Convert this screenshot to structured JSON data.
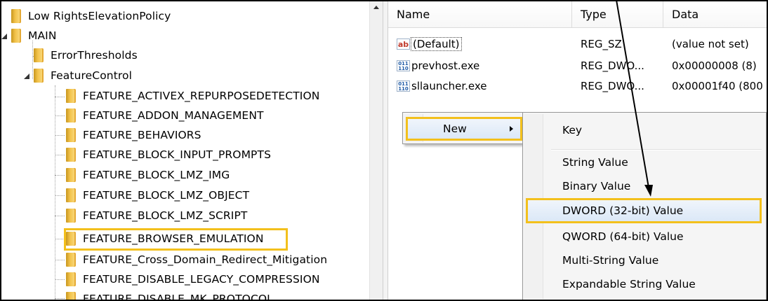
{
  "tree": {
    "items": [
      {
        "label": "Low RightsElevationPolicy",
        "state": "collapsed"
      },
      {
        "label": "MAIN",
        "state": "expanded"
      },
      {
        "label": "ErrorThresholds",
        "state": "leaf"
      },
      {
        "label": "FeatureControl",
        "state": "expanded"
      },
      {
        "label": "FEATURE_ACTIVEX_REPURPOSEDETECTION",
        "state": "leaf"
      },
      {
        "label": "FEATURE_ADDON_MANAGEMENT",
        "state": "leaf"
      },
      {
        "label": "FEATURE_BEHAVIORS",
        "state": "leaf"
      },
      {
        "label": "FEATURE_BLOCK_INPUT_PROMPTS",
        "state": "leaf"
      },
      {
        "label": "FEATURE_BLOCK_LMZ_IMG",
        "state": "leaf"
      },
      {
        "label": "FEATURE_BLOCK_LMZ_OBJECT",
        "state": "leaf"
      },
      {
        "label": "FEATURE_BLOCK_LMZ_SCRIPT",
        "state": "leaf"
      },
      {
        "label": "FEATURE_BROWSER_EMULATION",
        "state": "selected"
      },
      {
        "label": "FEATURE_Cross_Domain_Redirect_Mitigation",
        "state": "leaf"
      },
      {
        "label": "FEATURE_DISABLE_LEGACY_COMPRESSION",
        "state": "leaf"
      },
      {
        "label": "FEATURE_DISABLE_MK_PROTOCOL",
        "state": "leaf"
      }
    ]
  },
  "values_pane": {
    "columns": [
      "Name",
      "Type",
      "Data"
    ],
    "rows": [
      {
        "name": "(Default)",
        "type": "REG_SZ",
        "data": "(value not set)",
        "icon": "string-value-icon"
      },
      {
        "name": "prevhost.exe",
        "type": "REG_DWO...",
        "data": "0x00000008 (8)",
        "icon": "binary-value-icon"
      },
      {
        "name": "sllauncher.exe",
        "type": "REG_DWO...",
        "data": "0x00001f40 (800",
        "icon": "binary-value-icon"
      }
    ]
  },
  "context_menu": {
    "new_label": "New"
  },
  "submenu": {
    "items": [
      "Key",
      "String Value",
      "Binary Value",
      "DWORD (32-bit) Value",
      "QWORD (64-bit) Value",
      "Multi-String Value",
      "Expandable String Value"
    ]
  },
  "colors": {
    "highlight": "#f3c01c",
    "folder": "#f2c24a"
  }
}
